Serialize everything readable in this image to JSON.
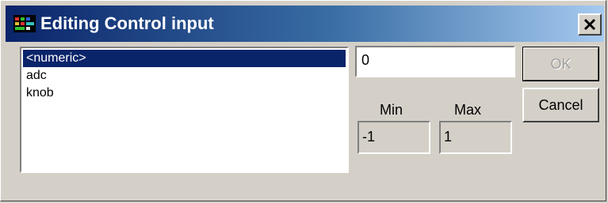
{
  "window": {
    "title": "Editing Control input",
    "close_label": "X"
  },
  "list": {
    "items": [
      "<numeric>",
      "adc",
      "knob"
    ],
    "selected": "<numeric>"
  },
  "value_field": {
    "value": "0"
  },
  "range": {
    "min_label": "Min",
    "max_label": "Max",
    "min_value": "-1",
    "max_value": "1"
  },
  "buttons": {
    "ok_label": "OK",
    "cancel_label": "Cancel"
  },
  "colors": {
    "title_gradient_start": "#0a246a",
    "title_gradient_end": "#a6caf0",
    "dialog_face": "#d4d0c8",
    "selection": "#0a246a"
  }
}
